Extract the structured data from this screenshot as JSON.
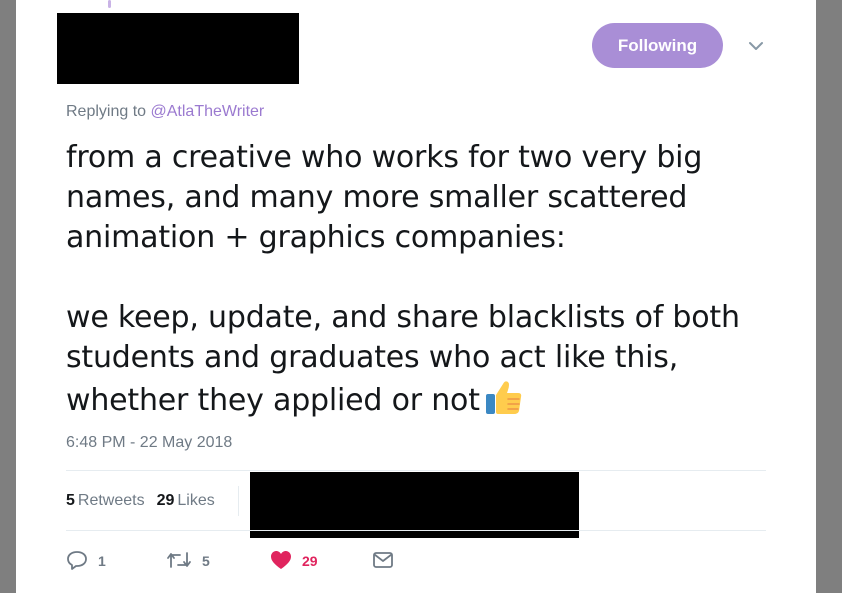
{
  "header": {
    "follow_label": "Following"
  },
  "reply": {
    "prefix": "Replying to",
    "handle": "@AtlaTheWriter"
  },
  "tweet": {
    "paragraph_1": "from a creative who works for two very big names, and many more smaller scattered animation + graphics companies:",
    "paragraph_2": "we keep, update, and share blacklists of both students and graduates who act like this, whether they applied or not",
    "emoji": "thumbs-up-icon",
    "timestamp": "6:48 PM - 22 May 2018"
  },
  "stats": {
    "retweets_count": "5",
    "retweets_label": "Retweets",
    "likes_count": "29",
    "likes_label": "Likes"
  },
  "actions": {
    "reply_count": "1",
    "retweet_count": "5",
    "like_count": "29",
    "like_color": "#e0245e"
  },
  "colors": {
    "accent": "#a98ed6",
    "handle": "#9b7ad0",
    "muted_text": "#6f7a85"
  }
}
